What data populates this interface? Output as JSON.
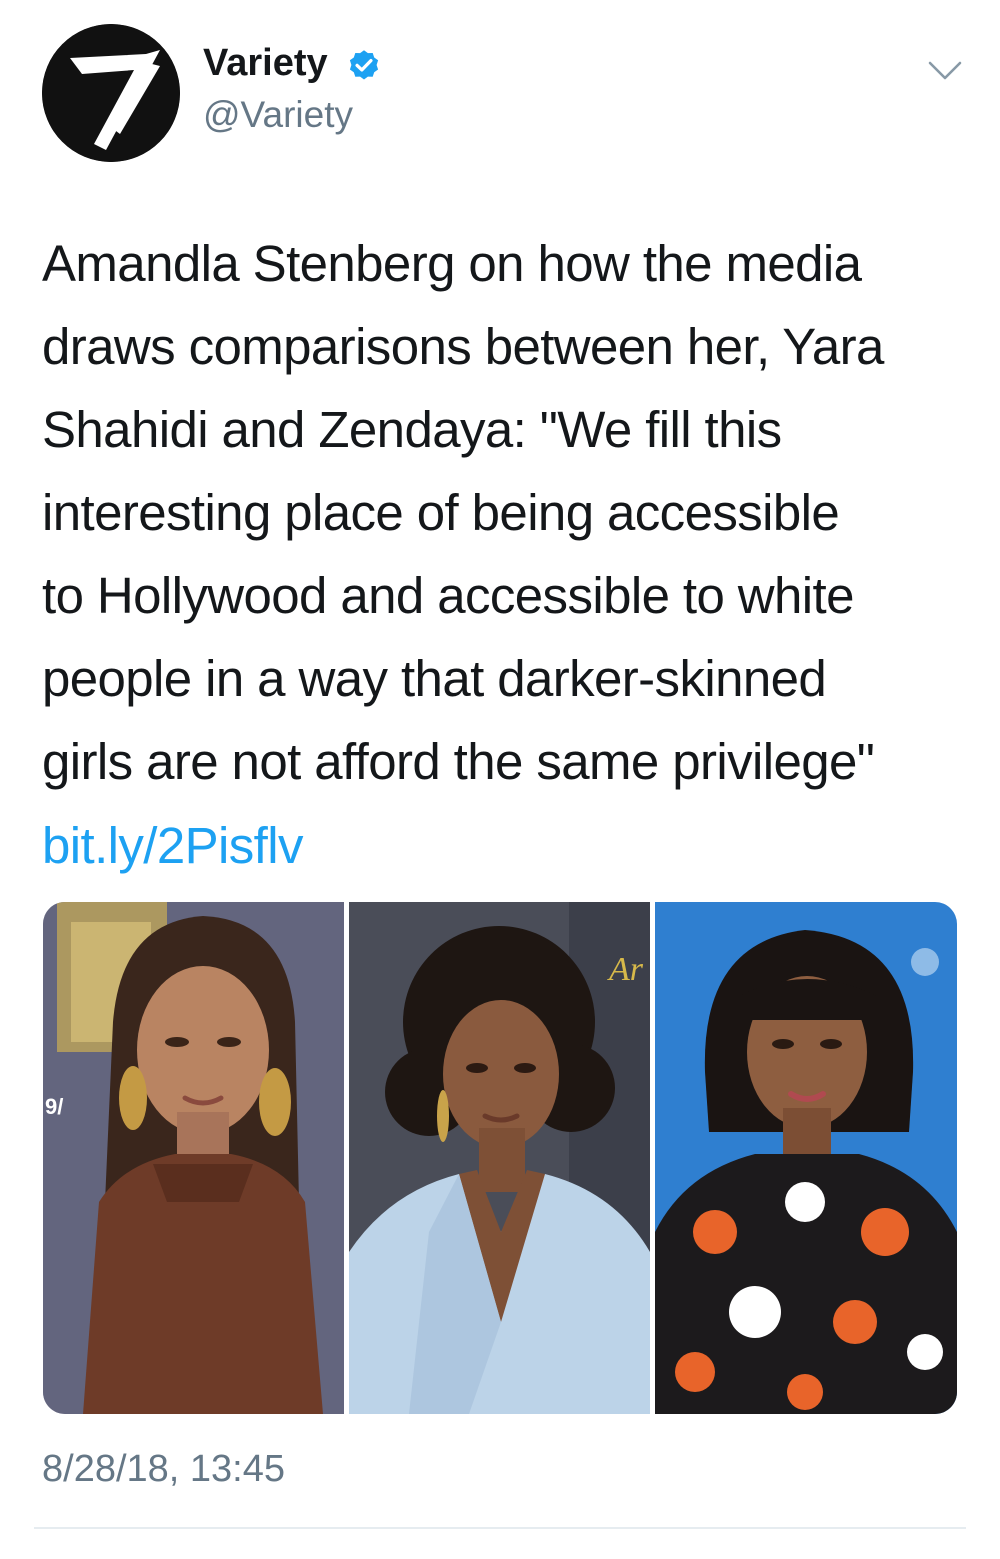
{
  "author": {
    "name": "Variety",
    "handle": "@Variety",
    "verified": true,
    "avatar_icon": "variety-v-logo-icon"
  },
  "tweet": {
    "text_lines": [
      "Amandla Stenberg on how the media",
      "draws comparisons between her, Yara",
      "Shahidi and Zendaya: \"We fill this",
      "interesting place of being accessible",
      "to Hollywood and accessible to white",
      "people in a way that darker-skinned",
      "girls are not afford the same privilege\""
    ],
    "link": "bit.ly/2Pisflv",
    "timestamp": "8/28/18, 13:45"
  },
  "media": {
    "photo_count": 3,
    "photo_overlay_text": [
      "9/",
      "Ar"
    ]
  },
  "colors": {
    "link": "#1da1f2",
    "verified_badge": "#1da1f2",
    "secondary_text": "#657786",
    "primary_text": "#14171a",
    "divider": "#e6ecf0"
  },
  "icons": {
    "verified": "verified-badge-icon",
    "menu": "chevron-down-icon"
  }
}
